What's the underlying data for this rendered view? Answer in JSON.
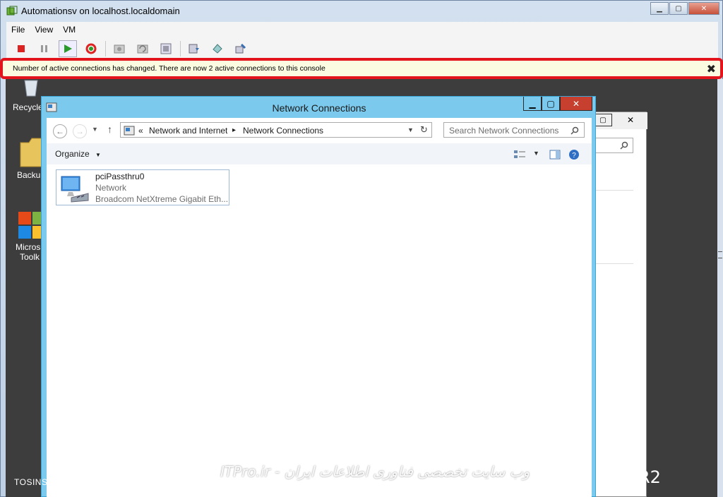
{
  "window": {
    "title": "Automationsv on localhost.localdomain",
    "icon": "vmware-console-icon"
  },
  "menu": {
    "items": [
      "File",
      "View",
      "VM"
    ]
  },
  "toolbar": {
    "buttons": [
      {
        "name": "power-off-icon"
      },
      {
        "name": "suspend-icon"
      },
      {
        "name": "power-on-icon"
      },
      {
        "name": "reset-icon"
      },
      {
        "name": "snapshot-icon"
      },
      {
        "name": "revert-snapshot-icon"
      },
      {
        "name": "snapshot-manager-icon"
      },
      {
        "name": "vm-settings-icon"
      },
      {
        "name": "connect-cd-icon"
      },
      {
        "name": "connect-floppy-icon"
      }
    ]
  },
  "notification": {
    "message": "Number of active connections has changed. There are now 2 active connections to this console",
    "close": "✖"
  },
  "desktop": {
    "icons": [
      {
        "label": "Recycle"
      },
      {
        "label": "Backu"
      },
      {
        "label": "Micros",
        "label2": "Toolk"
      }
    ],
    "watermark_fa": "وب سایت تخصصی فناوری اطلاعات ایران - ITPro.ir",
    "watermark_en": "TOSINSO.COM",
    "corner_text": "R2"
  },
  "network_window": {
    "title": "Network Connections",
    "breadcrumb": {
      "prefix": "«",
      "parent": "Network and Internet",
      "sep": "▸",
      "current": "Network Connections"
    },
    "search_placeholder": "Search Network Connections",
    "organize": "Organize",
    "adapter": {
      "name": "pciPassthru0",
      "status": "Network",
      "device": "Broadcom NetXtreme Gigabit Eth..."
    }
  },
  "colors": {
    "accent": "#7bc9ec",
    "highlight_border": "#e3141c",
    "notification_bg": "#fbfbe1"
  }
}
